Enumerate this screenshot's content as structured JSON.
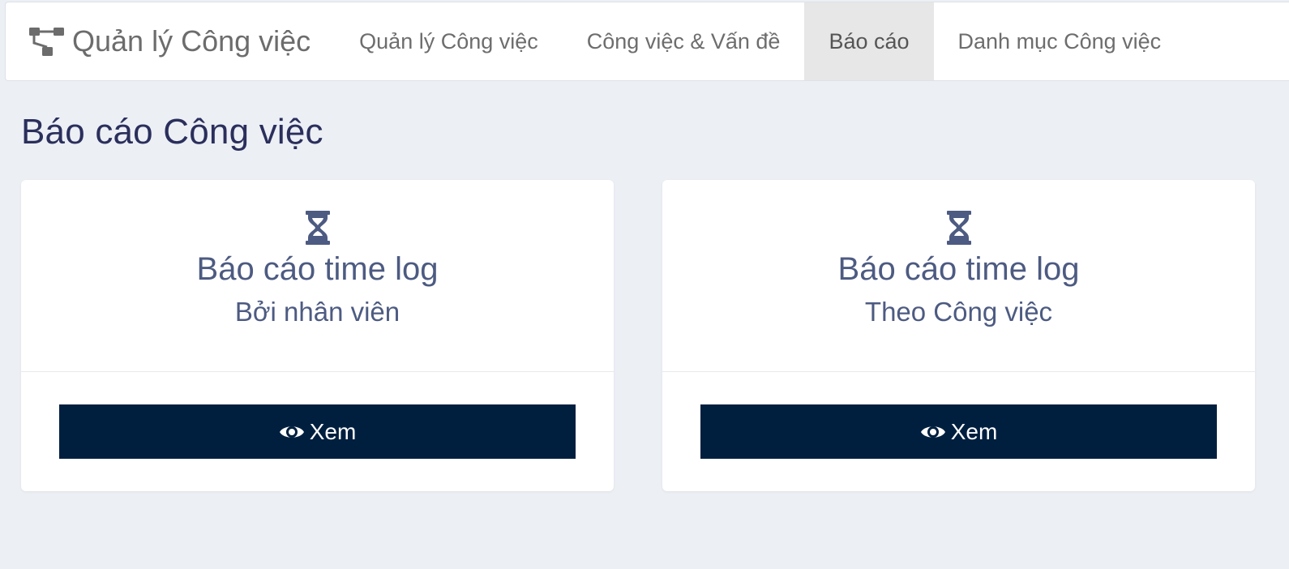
{
  "navbar": {
    "brand_icon": "sitemap-icon",
    "brand_label": "Quản lý Công việc",
    "items": [
      {
        "label": "Quản lý Công việc",
        "active": false
      },
      {
        "label": "Công việc & Vấn đề",
        "active": false
      },
      {
        "label": "Báo cáo",
        "active": true
      },
      {
        "label": "Danh mục Công việc",
        "active": false
      }
    ]
  },
  "page": {
    "title": "Báo cáo Công việc"
  },
  "cards": [
    {
      "icon": "hourglass-icon",
      "title": "Báo cáo time log",
      "subtitle": "Bởi nhân viên",
      "button_icon": "eye-icon",
      "button_label": "Xem"
    },
    {
      "icon": "hourglass-icon",
      "title": "Báo cáo time log",
      "subtitle": "Theo Công việc",
      "button_icon": "eye-icon",
      "button_label": "Xem"
    }
  ],
  "colors": {
    "background": "#eceff4",
    "title": "#2b2f5c",
    "card_text": "#4d5b82",
    "button": "#001f3f",
    "active_tab": "#e7e7e7"
  }
}
